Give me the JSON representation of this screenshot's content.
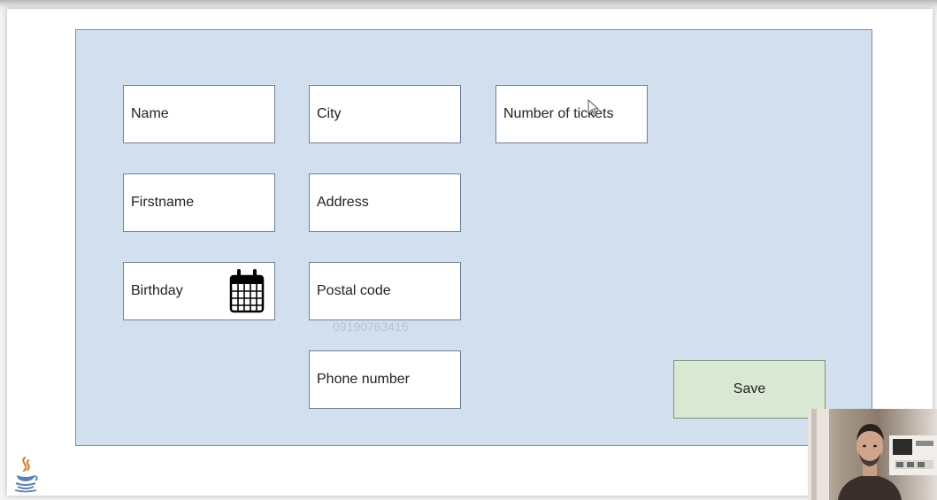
{
  "fields": {
    "name": "Name",
    "firstname": "Firstname",
    "birthday": "Birthday",
    "city": "City",
    "address": "Address",
    "postal_code": "Postal code",
    "phone_number": "Phone number",
    "tickets": "Number of tickets"
  },
  "ghost_text": "09190763415",
  "save_label": "Save",
  "icons": {
    "calendar": "calendar-icon",
    "cursor": "mouse-pointer-icon",
    "java": "java-coffee-cup-icon"
  },
  "colors": {
    "panel": "#d2dfef",
    "field": "#ffffff",
    "save": "#d9e8d3",
    "border": "#6f7f99"
  }
}
